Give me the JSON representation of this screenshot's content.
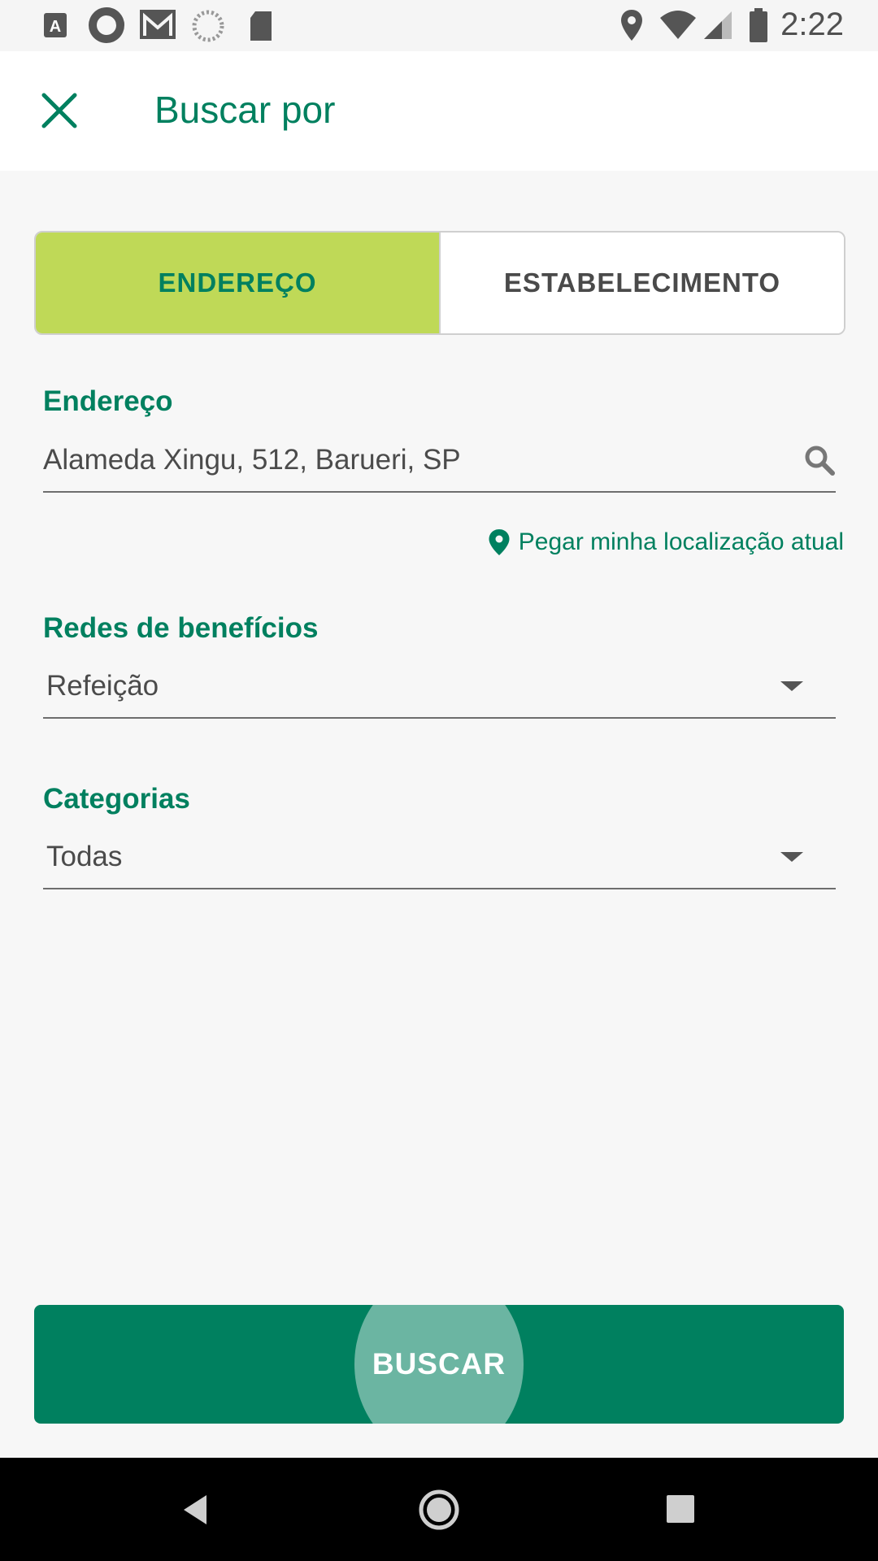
{
  "status_bar": {
    "time": "2:22",
    "icons": [
      "a-badge-icon",
      "sync-icon",
      "gmail-icon",
      "loading-icon",
      "sd-card-icon",
      "location-icon",
      "wifi-icon",
      "signal-icon",
      "battery-icon"
    ]
  },
  "app_bar": {
    "close_icon": "close-icon",
    "title": "Buscar por"
  },
  "tabs": [
    {
      "label": "ENDEREÇO",
      "active": true
    },
    {
      "label": "ESTABELECIMENTO",
      "active": false
    }
  ],
  "address": {
    "label": "Endereço",
    "value": "Alameda Xingu, 512, Barueri, SP",
    "icon": "search-icon"
  },
  "location_link": {
    "label": "Pegar minha localização atual",
    "icon": "map-pin-icon"
  },
  "benefits": {
    "label": "Redes de benefícios",
    "selected": "Refeição"
  },
  "categories": {
    "label": "Categorias",
    "selected": "Todas"
  },
  "search_button": {
    "label": "BUSCAR"
  },
  "colors": {
    "primary": "#00805f",
    "active_tab": "#bfd957",
    "background": "#f7f7f7"
  },
  "nav_bar": {
    "icons": [
      "back-icon",
      "home-icon",
      "recents-icon"
    ]
  }
}
